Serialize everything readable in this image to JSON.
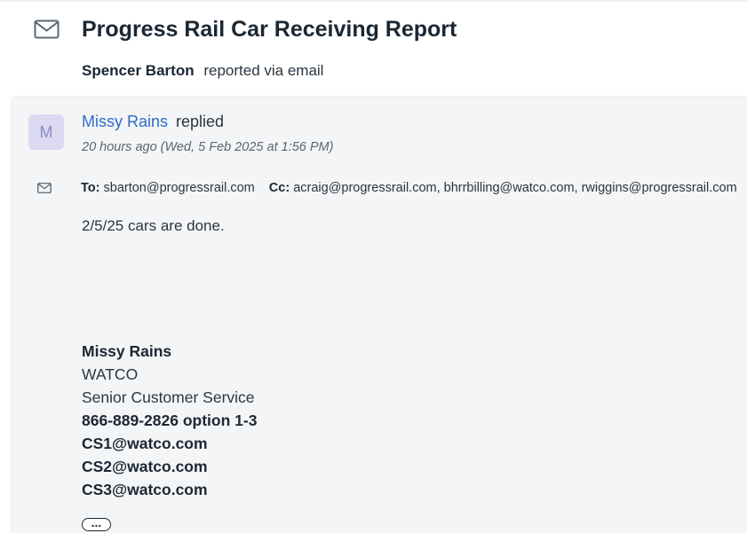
{
  "ticket": {
    "title": "Progress Rail Car Receiving Report",
    "reporter_name": "Spencer Barton",
    "reporter_via": "reported via email"
  },
  "reply": {
    "avatar_initial": "M",
    "author": "Missy Rains",
    "action": "replied",
    "timestamp": "20 hours ago (Wed, 5 Feb 2025 at 1:56 PM)",
    "to_label": "To:",
    "to": "sbarton@progressrail.com",
    "cc_label": "Cc:",
    "cc": "acraig@progressrail.com, bhrrbilling@watco.com, rwiggins@progressrail.com",
    "body": "2/5/25 cars are done.",
    "signature": {
      "name": "Missy Rains",
      "company": "WATCO",
      "role": "Senior Customer Service",
      "phone": "866-889-2826 option 1-3",
      "email1": "CS1@watco.com",
      "email2": "CS2@watco.com",
      "email3": "CS3@watco.com"
    },
    "more_label": "..."
  },
  "colors": {
    "link": "#2d6cc6",
    "avatar_bg": "#dcdaf3",
    "avatar_text": "#8d8ac2",
    "panel_bg": "#f4f5f6"
  },
  "icons": {
    "header": "envelope-icon",
    "recipients": "envelope-icon"
  }
}
